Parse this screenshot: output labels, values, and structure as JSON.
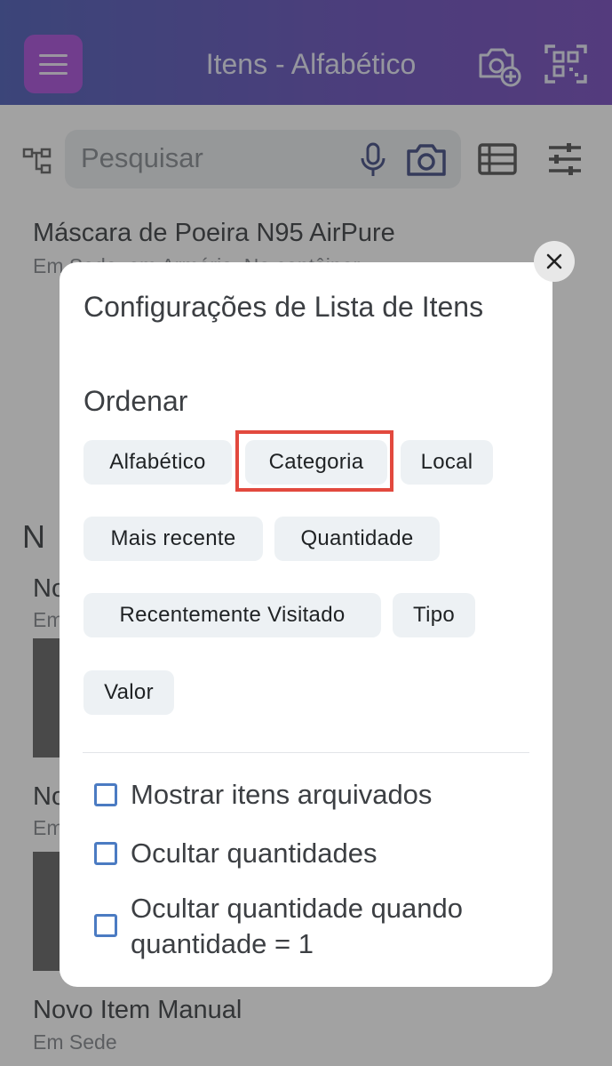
{
  "header": {
    "title": "Itens - Alfabético"
  },
  "search": {
    "placeholder": "Pesquisar"
  },
  "background_list": {
    "item1_name": "Máscara de Poeira N95 AirPure",
    "item1_location": "Em Sede, em Armário, No contêiner",
    "section_letter": "N",
    "item2_prefix": "No",
    "item2_sub": "Em",
    "item3_prefix": "No",
    "item3_sub": "Em",
    "item4_name": "Novo Item Manual",
    "item4_sub": "Em Sede"
  },
  "dialog": {
    "title": "Configurações de Lista de Itens",
    "sort_heading": "Ordenar",
    "sort_options": [
      "Alfabético",
      "Categoria",
      "Local",
      "Mais recente",
      "Quantidade",
      "Recentemente Visitado",
      "Tipo",
      "Valor"
    ],
    "highlighted_option": "Categoria",
    "checkboxes": [
      {
        "label": "Mostrar itens arquivados",
        "checked": false
      },
      {
        "label": "Ocultar quantidades",
        "checked": false
      },
      {
        "label": "Ocultar quantidade quando quantidade = 1",
        "checked": false
      }
    ]
  },
  "colors": {
    "header_gradient_start": "#3b4db0",
    "header_gradient_end": "#6a3bb8",
    "menu_button": "#a23fd6",
    "highlight_border": "#e2493e",
    "checkbox_border": "#4b7bc2"
  },
  "icons": [
    "menu-icon",
    "camera-add-icon",
    "qr-scan-icon",
    "hierarchy-icon",
    "microphone-icon",
    "camera-icon",
    "list-view-icon",
    "filter-sliders-icon",
    "close-icon"
  ]
}
